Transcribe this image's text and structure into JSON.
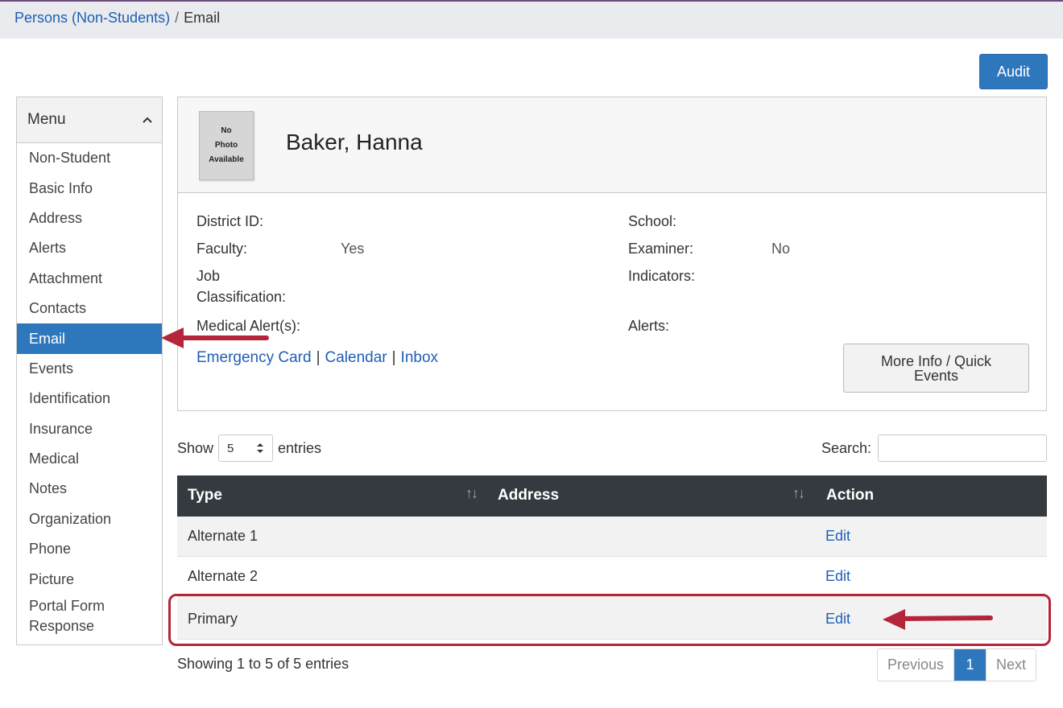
{
  "breadcrumb": {
    "parent": "Persons (Non-Students)",
    "separator": "/",
    "current": "Email"
  },
  "toolbar": {
    "audit_label": "Audit"
  },
  "menu": {
    "title": "Menu",
    "items": [
      {
        "label": "Non-Student"
      },
      {
        "label": "Basic Info"
      },
      {
        "label": "Address"
      },
      {
        "label": "Alerts"
      },
      {
        "label": "Attachment"
      },
      {
        "label": "Contacts"
      },
      {
        "label": "Email",
        "active": true
      },
      {
        "label": "Events"
      },
      {
        "label": "Identification"
      },
      {
        "label": "Insurance"
      },
      {
        "label": "Medical"
      },
      {
        "label": "Notes"
      },
      {
        "label": "Organization"
      },
      {
        "label": "Phone"
      },
      {
        "label": "Picture"
      },
      {
        "label": "Portal Form Response"
      }
    ]
  },
  "person": {
    "photo_text": [
      "No",
      "Photo",
      "Available"
    ],
    "name": "Baker, Hanna",
    "fields": {
      "district_id_label": "District ID:",
      "school_label": "School:",
      "faculty_label": "Faculty:",
      "faculty_value": "Yes",
      "examiner_label": "Examiner:",
      "examiner_value": "No",
      "job_label_1": "Job",
      "job_label_2": "Classification:",
      "indicators_label": "Indicators:",
      "medical_label": "Medical Alert(s):",
      "alerts_label": "Alerts:"
    },
    "links": [
      "Emergency Card",
      "Calendar",
      "Inbox"
    ],
    "link_separator": "|",
    "more_button_line1": "More Info / Quick",
    "more_button_line2": "Events"
  },
  "table_controls": {
    "show_label": "Show",
    "page_size": "5",
    "entries_label": "entries",
    "search_label": "Search:",
    "search_value": ""
  },
  "table": {
    "columns": [
      "Type",
      "Address",
      "Action"
    ],
    "rows": [
      {
        "type": "Alternate 1",
        "address": "",
        "action": "Edit"
      },
      {
        "type": "Alternate 2",
        "address": "",
        "action": "Edit"
      },
      {
        "type": "Primary",
        "address": "",
        "action": "Edit"
      }
    ]
  },
  "footer": {
    "info": "Showing 1 to 5 of 5 entries",
    "previous": "Previous",
    "current_page": "1",
    "next": "Next"
  },
  "colors": {
    "accent": "#2f77bd",
    "link": "#1f5fb5",
    "table_header": "#343a40",
    "annotation": "#b5253a"
  }
}
